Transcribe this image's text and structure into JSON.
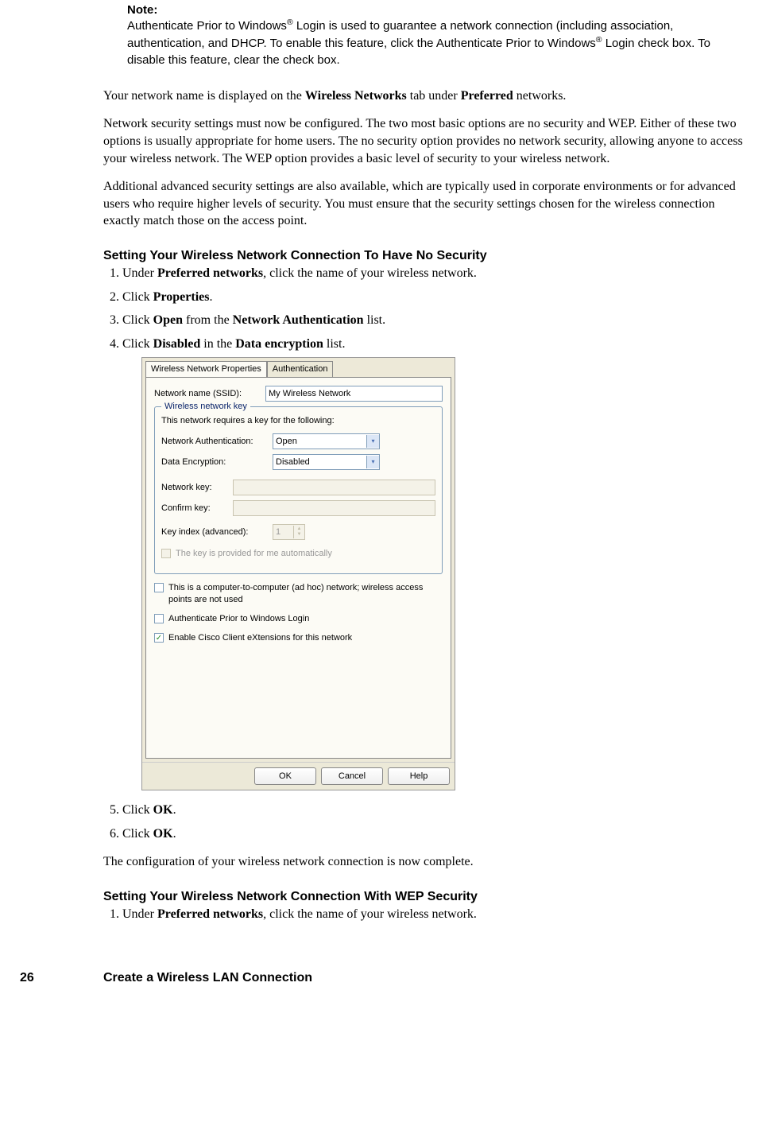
{
  "note": {
    "title": "Note:",
    "body_parts": [
      "Authenticate Prior to Windows",
      "®",
      " Login is used to guarantee a network connection (including association, authentication, and DHCP. To enable this feature, click the Authenticate Prior to Windows",
      "®",
      " Login check box. To disable this feature, clear the check box."
    ]
  },
  "para1_parts": [
    "Your network name is displayed on the ",
    "Wireless Networks",
    " tab under ",
    "Preferred",
    " networks."
  ],
  "para2": "Network security settings must now be configured. The two most basic options are no security and WEP. Either of these two options is usually appropriate for home users. The no security option provides no network security, allowing anyone to access your wireless network. The WEP option provides a basic level of security to your wireless network.",
  "para3": "Additional advanced security settings are also available, which are typically used in corporate environments or for advanced users who require higher levels of security. You must ensure that the security settings chosen for the wireless connection exactly match those on the access point.",
  "heading_nosec": "Setting Your Wireless Network Connection To Have No Security",
  "steps_nosec_a": [
    {
      "pre": "Under ",
      "b": "Preferred networks",
      "post": ", click the name of your wireless network."
    },
    {
      "pre": "Click ",
      "b": "Properties",
      "post": "."
    }
  ],
  "step3": {
    "pre": "Click ",
    "b1": "Open",
    "mid": " from the ",
    "b2": "Network Authentication",
    "post": " list."
  },
  "step4": {
    "pre": "Click ",
    "b1": "Disabled",
    "mid": " in the ",
    "b2": "Data encryption",
    "post": " list."
  },
  "dialog": {
    "tabs": [
      "Wireless Network Properties",
      "Authentication"
    ],
    "ssid_label": "Network name (SSID):",
    "ssid_value": "My Wireless Network",
    "key_legend": "Wireless network key",
    "key_intro": "This network requires a key for the following:",
    "auth_label": "Network Authentication:",
    "auth_value": "Open",
    "enc_label": "Data Encryption:",
    "enc_value": "Disabled",
    "netkey_label": "Network key:",
    "confirm_label": "Confirm key:",
    "keyindex_label": "Key index (advanced):",
    "keyindex_value": "1",
    "autokey_label": "The key is provided for me automatically",
    "adhoc_label": "This is a computer-to-computer (ad hoc) network; wireless access points are not used",
    "authprior_label": "Authenticate Prior to Windows Login",
    "cisco_label": "Enable Cisco Client eXtensions for this network",
    "ok": "OK",
    "cancel": "Cancel",
    "help": "Help"
  },
  "steps_nosec_b": [
    {
      "pre": "Click ",
      "b": "OK",
      "post": "."
    },
    {
      "pre": "Click ",
      "b": "OK",
      "post": "."
    }
  ],
  "para_complete": "The configuration of your wireless network connection is now complete.",
  "heading_wep": "Setting Your Wireless Network Connection With WEP Security",
  "steps_wep": [
    {
      "pre": "Under ",
      "b": "Preferred networks",
      "post": ", click the name of your wireless network."
    }
  ],
  "footer": {
    "page_number": "26",
    "title": "Create a Wireless LAN Connection"
  }
}
